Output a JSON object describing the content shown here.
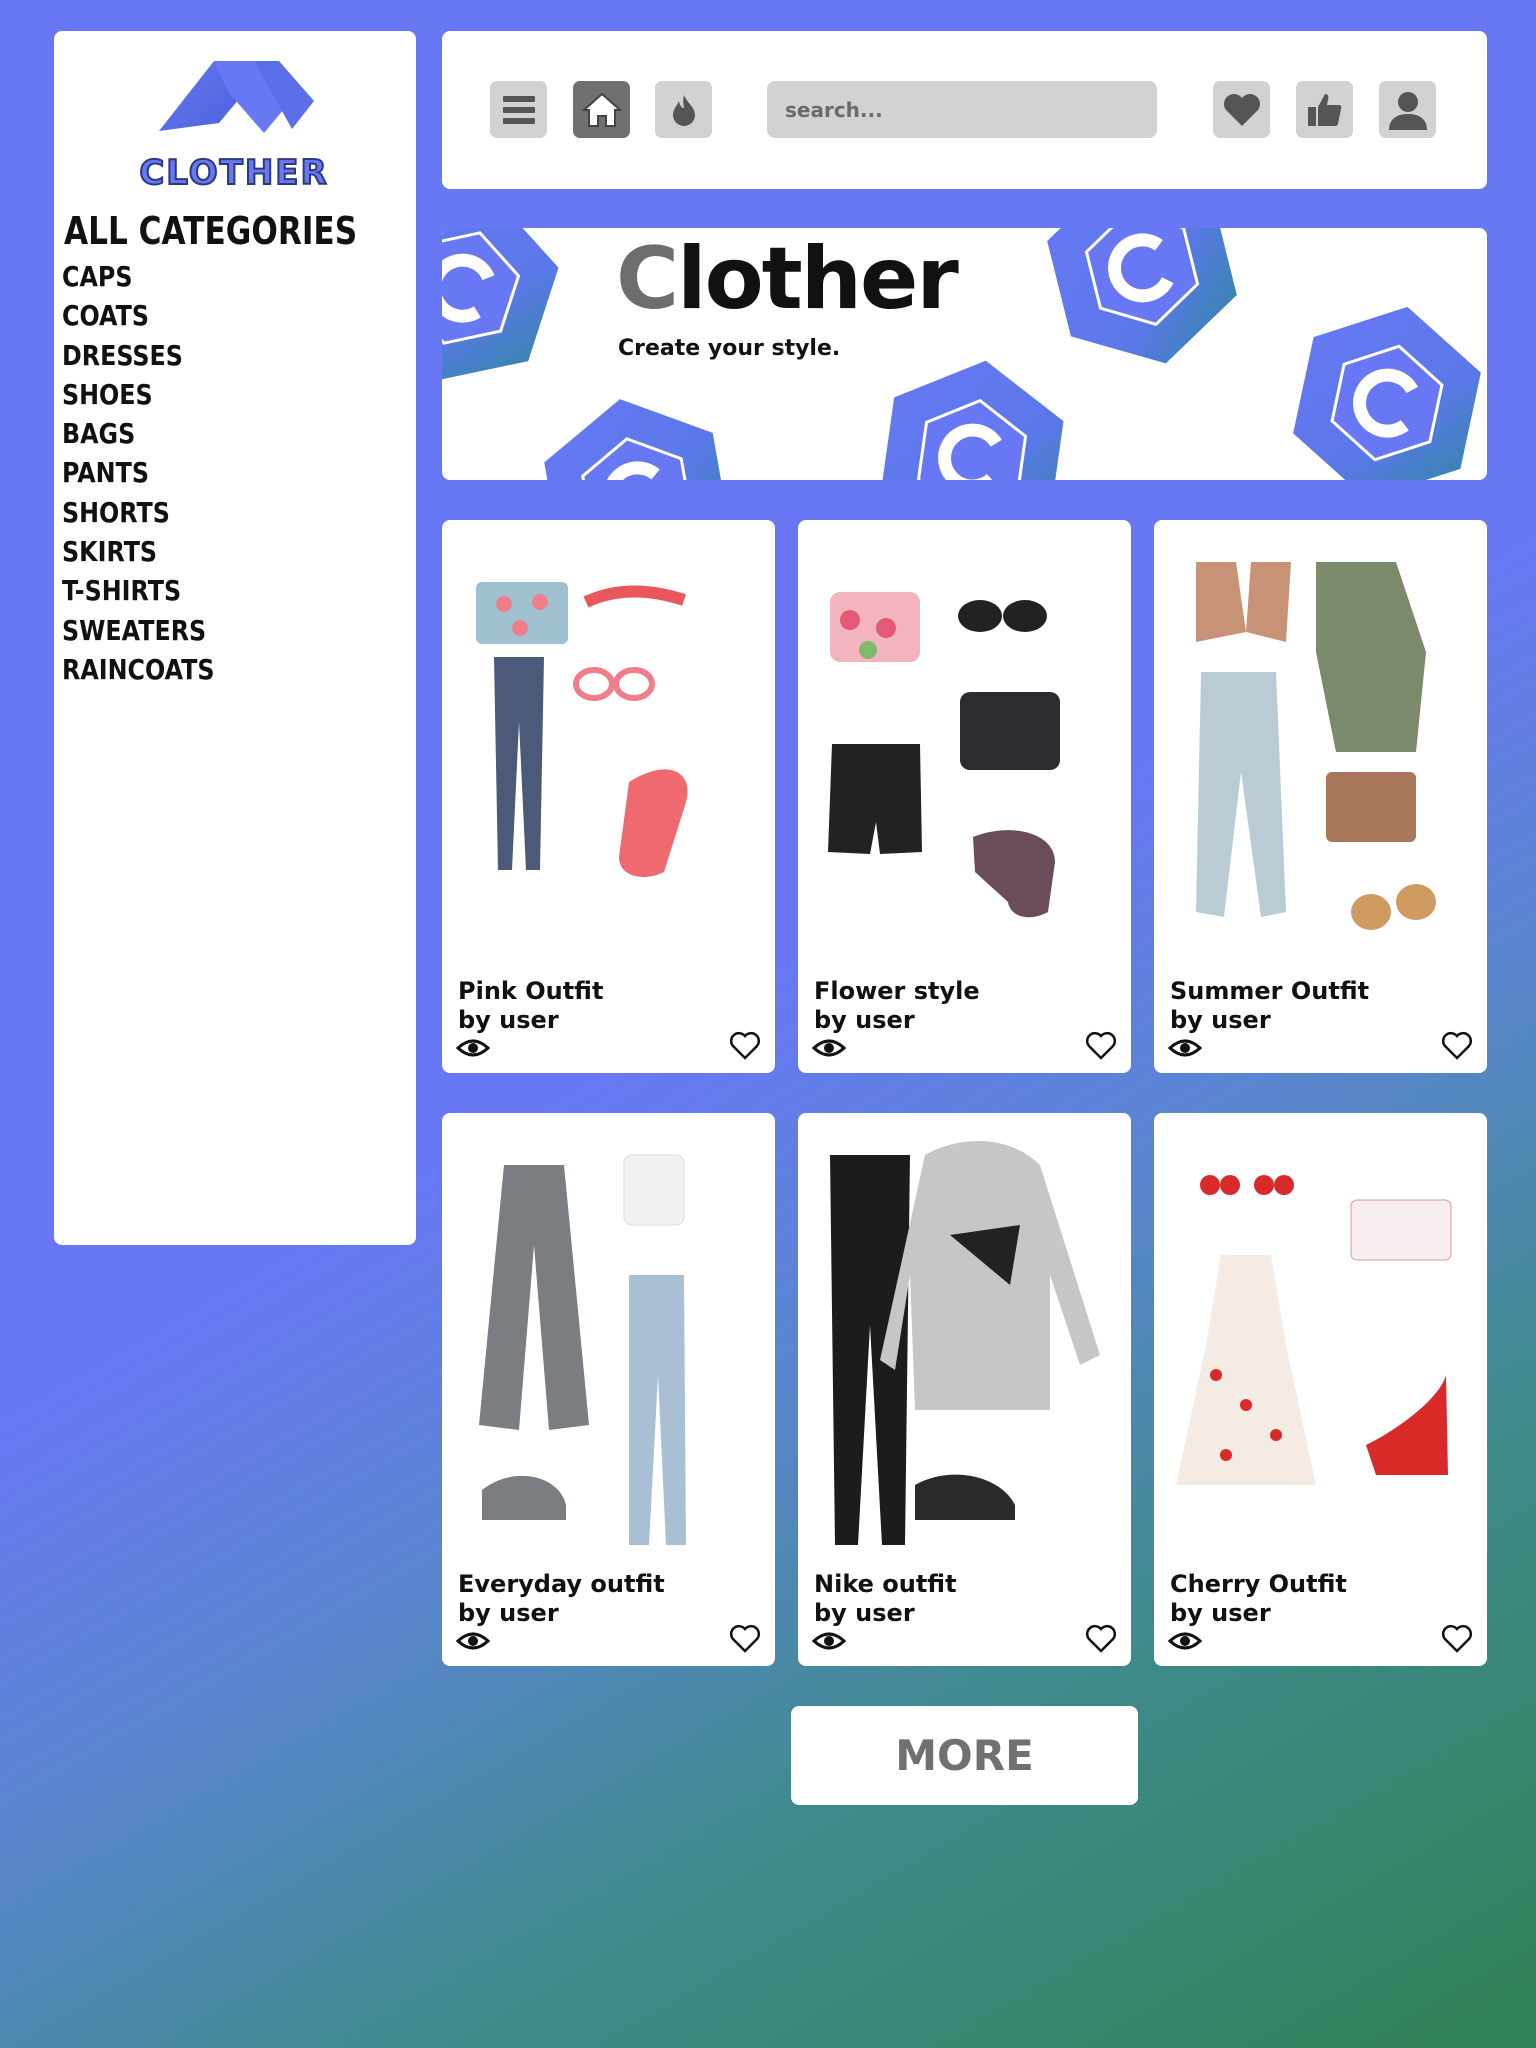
{
  "brand": {
    "name": "CLOTHER"
  },
  "sidebar": {
    "heading": "ALL CATEGORIES",
    "categories": [
      "CAPS",
      "COATS",
      "DRESSES",
      "SHOES",
      "BAGS",
      "PANTS",
      "SHORTS",
      "SKIRTS",
      "T-SHIRTS",
      "SWEATERS",
      "RAINCOATS"
    ]
  },
  "topbar": {
    "icons": [
      "menu-icon",
      "home-icon",
      "flame-icon",
      "heart-icon",
      "thumbs-up-icon",
      "user-icon"
    ],
    "search": {
      "placeholder": "search...",
      "value": ""
    }
  },
  "banner": {
    "title_first": "C",
    "title_rest": "lother",
    "subtitle": "Create your style."
  },
  "outfits": [
    {
      "title": "Pink Outfit",
      "author": "by user"
    },
    {
      "title": "Flower style",
      "author": "by user"
    },
    {
      "title": "Summer Outfit",
      "author": "by user"
    },
    {
      "title": "Everyday outfit",
      "author": "by user"
    },
    {
      "title": "Nike outfit",
      "author": "by user"
    },
    {
      "title": "Cherry Outfit",
      "author": "by user"
    }
  ],
  "more_button": {
    "label": "MORE"
  },
  "colors": {
    "accent": "#6878f5",
    "panel": "#ffffff",
    "icon_bg": "#d2d2d2",
    "icon_dark": "#707070",
    "gradient_end": "#318155"
  }
}
